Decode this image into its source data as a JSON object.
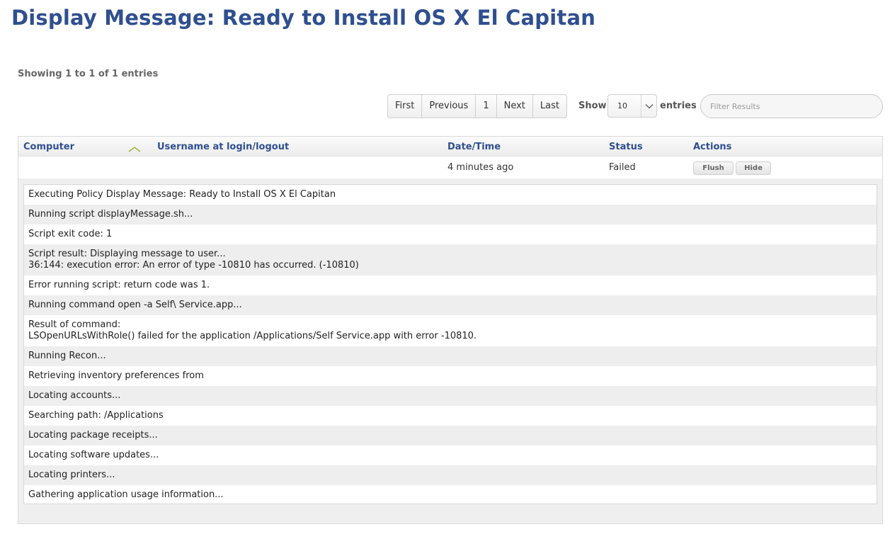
{
  "page": {
    "title": "Display Message: Ready to Install OS X El Capitan",
    "showing": "Showing 1 to 1 of 1 entries"
  },
  "pagination": {
    "first": "First",
    "previous": "Previous",
    "page": "1",
    "next": "Next",
    "last": "Last"
  },
  "length": {
    "show_label": "Show",
    "selected": "10",
    "entries_label": "entries"
  },
  "filter": {
    "placeholder": "Filter Results"
  },
  "table": {
    "columns": {
      "computer": "Computer",
      "username": "Username at login/logout",
      "datetime": "Date/Time",
      "status": "Status",
      "actions": "Actions"
    },
    "sort": {
      "column": "computer",
      "icon": "chevron-up-icon",
      "color": "#9bb531"
    },
    "rows": [
      {
        "computer": "",
        "username": "",
        "datetime": "4 minutes ago",
        "status": "Failed",
        "actions": {
          "flush": "Flush",
          "hide": "Hide"
        }
      }
    ]
  },
  "log": [
    "Executing Policy Display Message: Ready to Install OS X El Capitan",
    "Running script displayMessage.sh...",
    "Script exit code: 1",
    "Script result: Displaying message to user...\n36:144: execution error: An error of type -10810 has occurred. (-10810)",
    "Error running script: return code was 1.",
    "Running command open -a Self\\ Service.app...",
    "Result of command:\nLSOpenURLsWithRole() failed for the application /Applications/Self Service.app with error -10810.",
    "Running Recon...",
    "Retrieving inventory preferences from",
    "Locating accounts...",
    "Searching path: /Applications",
    "Locating package receipts...",
    "Locating software updates...",
    "Locating printers...",
    "Gathering application usage information..."
  ],
  "colors": {
    "title": "#2f4f8f",
    "header_link": "#2f4f8f",
    "accent_sort": "#9bb531"
  }
}
